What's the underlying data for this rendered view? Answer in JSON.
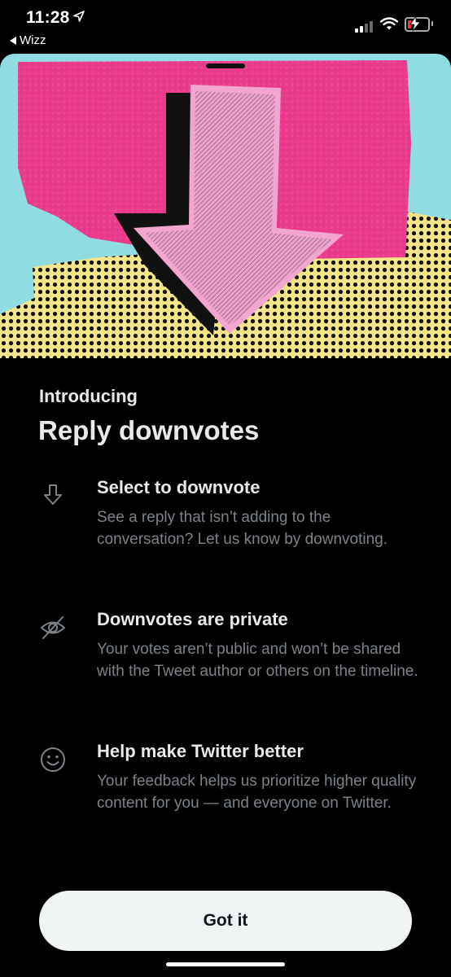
{
  "status_bar": {
    "time": "11:28",
    "back_app": "Wizz",
    "battery_color": "#ff3b30"
  },
  "hero": {
    "colors": {
      "cyan": "#8fdde3",
      "pink": "#ea3b8c",
      "yellow": "#f5e58a",
      "arrow_pink": "#f2a6cf",
      "black": "#111111"
    }
  },
  "sheet": {
    "overline": "Introducing",
    "title": "Reply downvotes",
    "features": [
      {
        "icon": "arrow-down-icon",
        "title": "Select to downvote",
        "description": "See a reply that isn’t adding to the conversation? Let us know by downvoting."
      },
      {
        "icon": "eye-slash-icon",
        "title": "Downvotes are private",
        "description": "Your votes aren’t public and won’t be shared with the Tweet author or others on the timeline."
      },
      {
        "icon": "smiley-icon",
        "title": "Help make Twitter better",
        "description": "Your feedback helps us prioritize higher quality content for you — and everyone on Twitter."
      }
    ],
    "button_label": "Got it"
  }
}
